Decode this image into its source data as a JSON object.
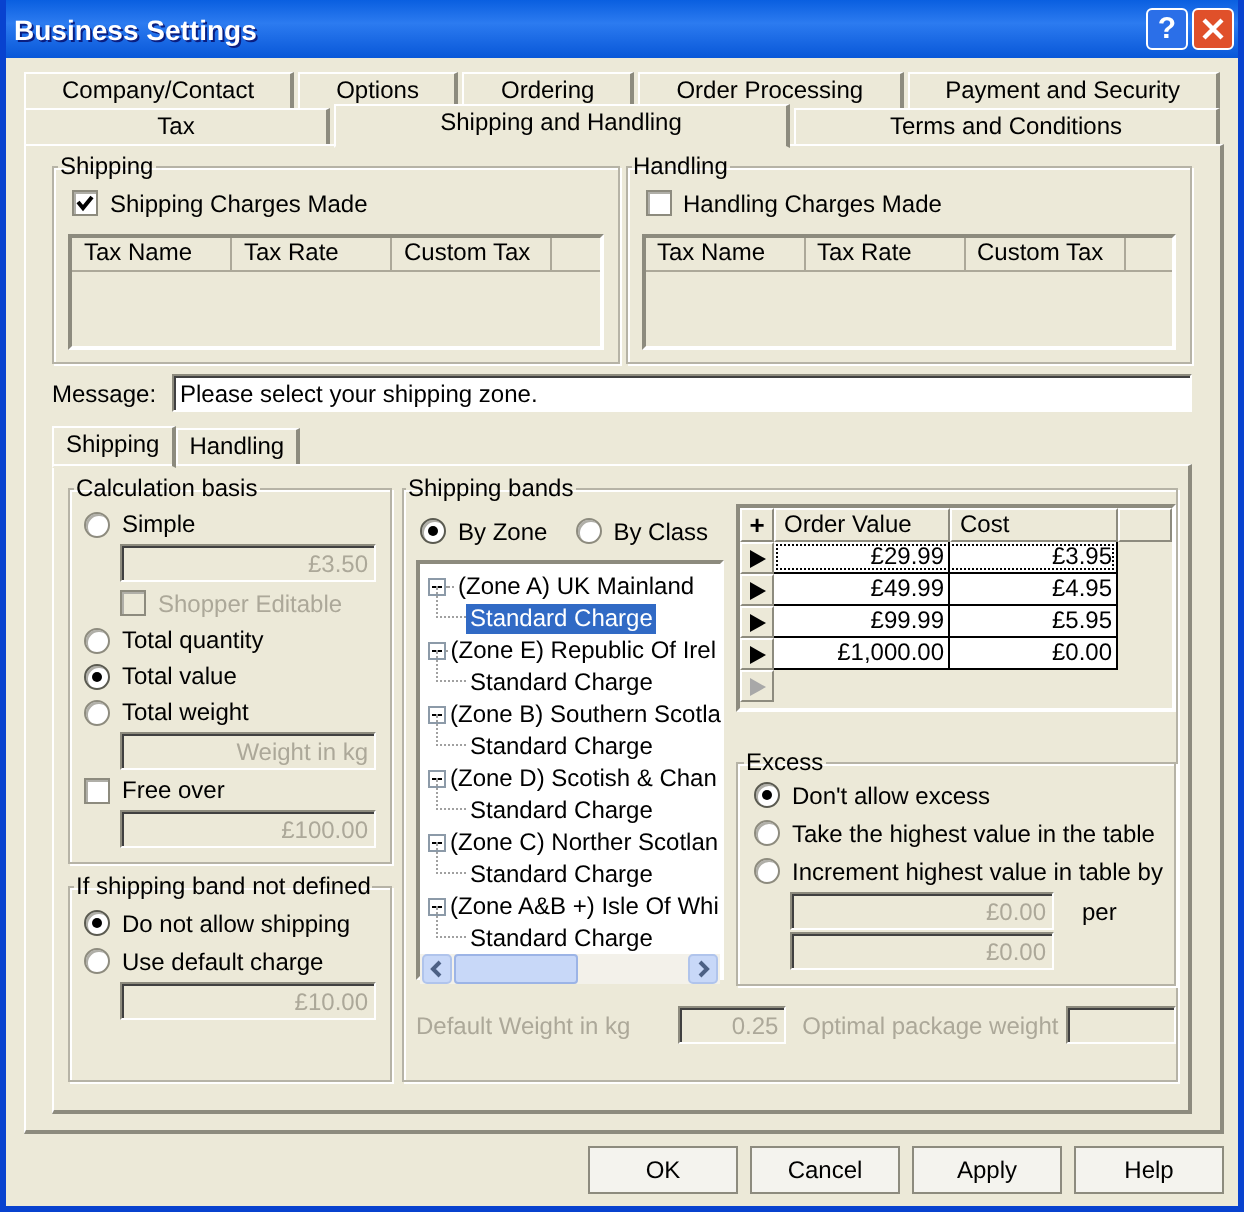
{
  "window": {
    "title": "Business Settings",
    "help_button": "?"
  },
  "tabs": [
    [
      {
        "label": "Company/Contact",
        "selected": false
      },
      {
        "label": "Options",
        "selected": false
      },
      {
        "label": "Ordering",
        "selected": false
      },
      {
        "label": "Order Processing",
        "selected": false
      },
      {
        "label": "Payment and Security",
        "selected": false
      }
    ],
    [
      {
        "label": "Tax",
        "selected": false
      },
      {
        "label": "Shipping and Handling",
        "selected": true
      },
      {
        "label": "Terms and Conditions",
        "selected": false
      }
    ]
  ],
  "charge_groups": [
    {
      "legend": "Shipping",
      "checkbox": {
        "label": "Shipping Charges Made",
        "checked": true
      },
      "columns": [
        "Tax Name",
        "Tax Rate",
        "Custom Tax"
      ]
    },
    {
      "legend": "Handling",
      "checkbox": {
        "label": "Handling Charges Made",
        "checked": false
      },
      "columns": [
        "Tax Name",
        "Tax Rate",
        "Custom Tax"
      ]
    }
  ],
  "message": {
    "label": "Message:",
    "value": "Please select your shipping zone."
  },
  "inner_tabs": [
    {
      "label": "Shipping",
      "selected": true
    },
    {
      "label": "Handling",
      "selected": false
    }
  ],
  "calculation_basis": {
    "legend": "Calculation basis",
    "options": [
      {
        "kind": "radio",
        "label": "Simple",
        "selected": false,
        "children": [
          {
            "kind": "field",
            "value": "£3.50",
            "disabled": true
          },
          {
            "kind": "checkbox",
            "label": "Shopper Editable",
            "checked": false,
            "disabled": true
          }
        ]
      },
      {
        "kind": "radio",
        "label": "Total quantity",
        "selected": false
      },
      {
        "kind": "radio",
        "label": "Total value",
        "selected": true
      },
      {
        "kind": "radio",
        "label": "Total weight",
        "selected": false,
        "children": [
          {
            "kind": "field",
            "placeholder": "Weight in kg",
            "disabled": true
          }
        ]
      },
      {
        "kind": "checkbox",
        "label": "Free over",
        "checked": false,
        "children": [
          {
            "kind": "field",
            "value": "£100.00",
            "disabled": true
          }
        ]
      }
    ]
  },
  "band_not_defined": {
    "legend": "If shipping band not defined",
    "options": [
      {
        "kind": "radio",
        "label": "Do not allow shipping",
        "selected": true
      },
      {
        "kind": "radio",
        "label": "Use default charge",
        "selected": false,
        "children": [
          {
            "kind": "field",
            "value": "£10.00",
            "disabled": true
          }
        ]
      }
    ]
  },
  "shipping_bands": {
    "legend": "Shipping bands",
    "modes": [
      {
        "label": "By Zone",
        "selected": true
      },
      {
        "label": "By Class",
        "selected": false
      }
    ],
    "tree": [
      {
        "label": "(Zone A) UK Mainland",
        "expanded": true,
        "children": [
          {
            "label": "Standard Charge",
            "selected": true
          }
        ]
      },
      {
        "label": "(Zone E) Republic Of Irel",
        "expanded": true,
        "children": [
          {
            "label": "Standard Charge",
            "selected": false
          }
        ]
      },
      {
        "label": "(Zone B) Southern Scotla",
        "expanded": true,
        "children": [
          {
            "label": "Standard Charge",
            "selected": false
          }
        ]
      },
      {
        "label": "(Zone D) Scotish & Chan",
        "expanded": true,
        "children": [
          {
            "label": "Standard Charge",
            "selected": false
          }
        ]
      },
      {
        "label": "(Zone C) Norther Scotlan",
        "expanded": true,
        "children": [
          {
            "label": "Standard Charge",
            "selected": false
          }
        ]
      },
      {
        "label": "(Zone A&B +) Isle Of Whi",
        "expanded": true,
        "children": [
          {
            "label": "Standard Charge",
            "selected": false
          }
        ]
      }
    ],
    "grid": {
      "add_button": "+",
      "columns": [
        "Order Value",
        "Cost"
      ],
      "new_row_indicator": true,
      "rows": [
        {
          "order_value": "£29.99",
          "cost": "£3.95",
          "focused": true
        },
        {
          "order_value": "£49.99",
          "cost": "£4.95",
          "focused": false
        },
        {
          "order_value": "£99.99",
          "cost": "£5.95",
          "focused": false
        },
        {
          "order_value": "£1,000.00",
          "cost": "£0.00",
          "focused": false
        }
      ]
    },
    "excess": {
      "legend": "Excess",
      "options": [
        {
          "kind": "radio",
          "label": "Don't allow excess",
          "selected": true
        },
        {
          "kind": "radio",
          "label": "Take the highest value in the table",
          "selected": false
        },
        {
          "kind": "radio",
          "label": "Increment highest value in table by",
          "selected": false,
          "children": [
            {
              "kind": "field",
              "value": "£0.00",
              "disabled": true,
              "unit": "per"
            },
            {
              "kind": "field",
              "value": "£0.00",
              "disabled": true
            }
          ]
        }
      ]
    },
    "default_weight": {
      "label": "Default Weight in kg",
      "value": "0.25",
      "disabled": true
    },
    "optimal_weight": {
      "label": "Optimal package weight",
      "disabled": true
    }
  },
  "buttons": [
    "OK",
    "Cancel",
    "Apply",
    "Help"
  ]
}
